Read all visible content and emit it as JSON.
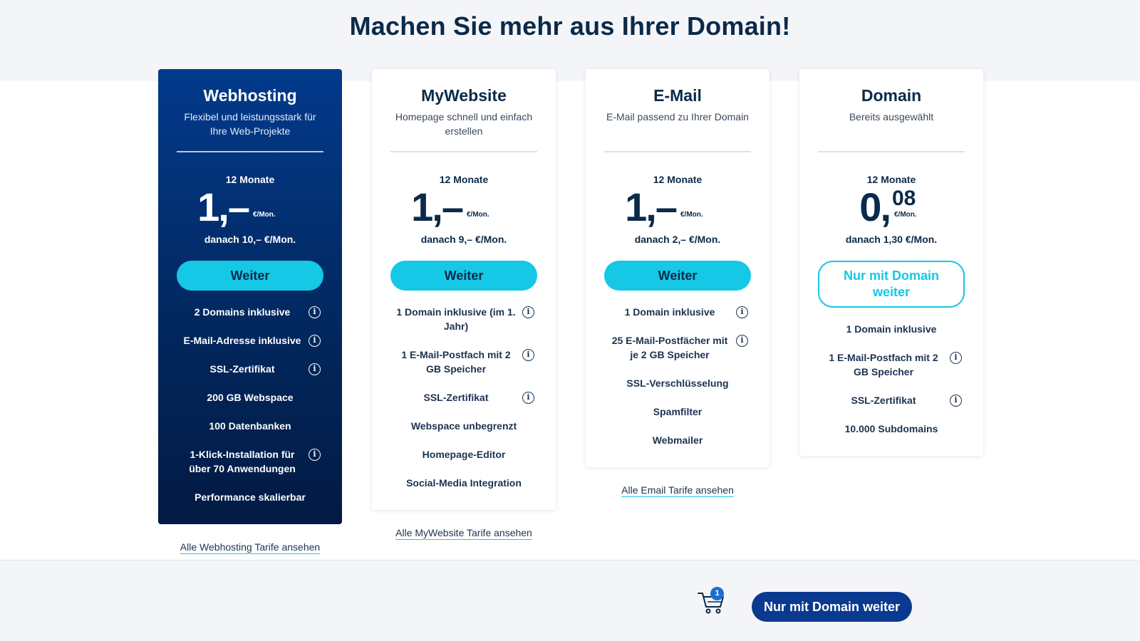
{
  "headline": "Machen Sie mehr aus Ihrer Domain!",
  "colors": {
    "accent": "#14c8e6",
    "brand_dark": "#0a3a8f"
  },
  "plans": [
    {
      "title": "Webhosting",
      "subtitle": "Flexibel und leistungsstark für Ihre Web-Projekte",
      "term": "12 Monate",
      "price_main": "1,–",
      "price_cents": "",
      "price_unit": "€/Mon.",
      "after": "danach 10,– €/Mon.",
      "button": "Weiter",
      "features": [
        {
          "text": "2 Domains inklusive",
          "info": true
        },
        {
          "text": "E-Mail-Adresse inklusive",
          "info": true
        },
        {
          "text": "SSL-Zertifikat",
          "info": true
        },
        {
          "text": "200 GB Webspace",
          "info": false
        },
        {
          "text": "100 Datenbanken",
          "info": false
        },
        {
          "text": "1-Klick-Installation für über 70 Anwendungen",
          "info": true
        },
        {
          "text": "Performance skalierbar",
          "info": false
        }
      ],
      "link": "Alle Webhosting Tarife ansehen"
    },
    {
      "title": "MyWebsite",
      "subtitle": "Homepage schnell und einfach erstellen",
      "term": "12 Monate",
      "price_main": "1,–",
      "price_cents": "",
      "price_unit": "€/Mon.",
      "after": "danach 9,– €/Mon.",
      "button": "Weiter",
      "features": [
        {
          "text": "1 Domain inklusive (im 1. Jahr)",
          "info": true
        },
        {
          "text": "1 E-Mail-Postfach mit 2 GB Speicher",
          "info": true
        },
        {
          "text": "SSL-Zertifikat",
          "info": true
        },
        {
          "text": "Webspace unbegrenzt",
          "info": false
        },
        {
          "text": "Homepage-Editor",
          "info": false
        },
        {
          "text": "Social-Media Integration",
          "info": false
        }
      ],
      "link": "Alle MyWebsite Tarife ansehen"
    },
    {
      "title": "E-Mail",
      "subtitle": "E-Mail passend zu Ihrer Domain",
      "term": "12 Monate",
      "price_main": "1,–",
      "price_cents": "",
      "price_unit": "€/Mon.",
      "after": "danach 2,– €/Mon.",
      "button": "Weiter",
      "features": [
        {
          "text": "1 Domain inklusive",
          "info": true
        },
        {
          "text": "25 E-Mail-Postfächer mit je 2 GB Speicher",
          "info": true
        },
        {
          "text": "SSL-Verschlüsselung",
          "info": false
        },
        {
          "text": "Spamfilter",
          "info": false
        },
        {
          "text": "Webmailer",
          "info": false
        }
      ],
      "link": "Alle Email Tarife ansehen"
    },
    {
      "title": "Domain",
      "subtitle": "Bereits ausgewählt",
      "term": "12 Monate",
      "price_main": "0,",
      "price_cents": "08",
      "price_unit": "€/Mon.",
      "after": "danach 1,30 €/Mon.",
      "button": "Nur mit Domain weiter",
      "features": [
        {
          "text": "1 Domain inklusive",
          "info": false
        },
        {
          "text": "1 E-Mail-Postfach mit 2 GB Speicher",
          "info": true
        },
        {
          "text": "SSL-Zertifikat",
          "info": true
        },
        {
          "text": "10.000 Subdomains",
          "info": false
        }
      ],
      "link": ""
    }
  ],
  "bottom_bar": {
    "cart_count": "1",
    "cart_icon": "shopping-cart-icon",
    "cta_label": "Nur mit Domain weiter"
  },
  "info_icon_glyph": "i"
}
